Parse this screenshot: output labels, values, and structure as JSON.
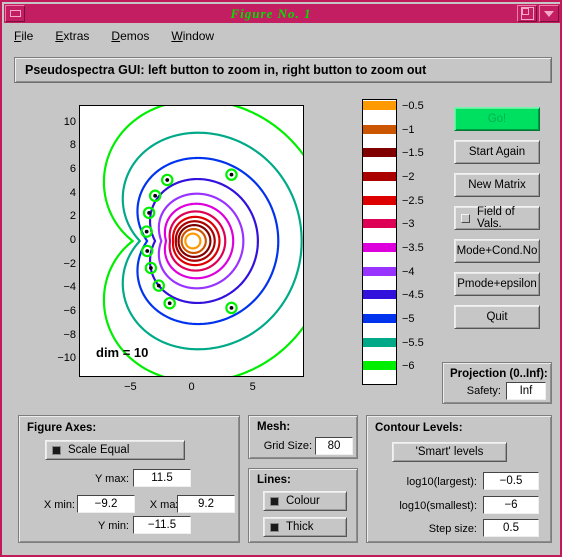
{
  "window": {
    "title": "Figure No. 1",
    "titlebar_color": "#c41e63",
    "title_text_color": "#00e000",
    "minimize_icon": "minimize-icon",
    "maximize_icon": "maximize-icon",
    "dropdown_icon": "chevron-down-icon"
  },
  "menubar": {
    "items": [
      {
        "label": "File",
        "mnemonic": "F"
      },
      {
        "label": "Extras",
        "mnemonic": "E"
      },
      {
        "label": "Demos",
        "mnemonic": "D"
      },
      {
        "label": "Window",
        "mnemonic": "W"
      }
    ]
  },
  "header": {
    "text": "Pseudospectra GUI: left button to zoom in, right button to zoom out"
  },
  "buttons": {
    "go": "Go!",
    "start_again": "Start Again",
    "new_matrix": "New Matrix",
    "field_of_vals": "Field of Vals.",
    "mode_cond_no": "Mode+Cond.No",
    "pmode_epsilon": "Pmode+epsilon",
    "quit": "Quit"
  },
  "projection": {
    "title": "Projection (0..Inf):",
    "safety_label": "Safety:",
    "safety_value": "Inf"
  },
  "figure_axes": {
    "title": "Figure Axes:",
    "scale_equal_label": "Scale Equal",
    "scale_equal_checked": true,
    "ymax_label": "Y max:",
    "ymax_value": "11.5",
    "xmin_label": "X min:",
    "xmin_value": "−9.2",
    "xmax_label": "X max:",
    "xmax_value": "9.2",
    "ymin_label": "Y min:",
    "ymin_value": "−11.5"
  },
  "mesh": {
    "title": "Mesh:",
    "grid_size_label": "Grid Size:",
    "grid_size_value": "80"
  },
  "lines": {
    "title": "Lines:",
    "colour_label": "Colour",
    "colour_checked": true,
    "thick_label": "Thick",
    "thick_checked": true
  },
  "contour_levels": {
    "title": "Contour Levels:",
    "smart_button": "'Smart' levels",
    "largest_label": "log10(largest):",
    "largest_value": "−0.5",
    "smallest_label": "log10(smallest):",
    "smallest_value": "−6",
    "step_label": "Step size:",
    "step_value": "0.5"
  },
  "chart_data": {
    "type": "line",
    "title": "",
    "annotation": "dim = 10",
    "xlabel": "",
    "ylabel": "",
    "xlim": [
      -9.2,
      9.2
    ],
    "ylim": [
      -11.5,
      11.5
    ],
    "xticks": [
      -5,
      0,
      5
    ],
    "yticks": [
      10,
      8,
      6,
      4,
      2,
      0,
      -2,
      -4,
      -6,
      -8,
      -10
    ],
    "grid": false,
    "legend": "colorbar",
    "colorbar": {
      "orientation": "vertical",
      "ticks": [
        "−0.5",
        "−1",
        "−1.5",
        "−2",
        "−2.5",
        "−3",
        "−3.5",
        "−4",
        "−4.5",
        "−5",
        "−5.5",
        "−6"
      ],
      "values": [
        -0.5,
        -1,
        -1.5,
        -2,
        -2.5,
        -3,
        -3.5,
        -4,
        -4.5,
        -5,
        -5.5,
        -6
      ],
      "colors": [
        "#ff9900",
        "#cc5500",
        "#800000",
        "#aa0000",
        "#dd0000",
        "#dd0055",
        "#dd00dd",
        "#9933ff",
        "#3311dd",
        "#0033ee",
        "#00aa88",
        "#00ee00"
      ]
    },
    "series": [
      {
        "name": "−0.5",
        "color": "#ff9900",
        "level": -0.5,
        "radius": 0.62
      },
      {
        "name": "−1",
        "color": "#cc5500",
        "level": -1,
        "radius": 1.0
      },
      {
        "name": "−1.5",
        "color": "#800000",
        "level": -1.5,
        "radius": 1.32
      },
      {
        "name": "−2",
        "color": "#aa0000",
        "level": -2,
        "radius": 1.62
      },
      {
        "name": "−2.5",
        "color": "#dd0000",
        "level": -2.5,
        "radius": 1.95
      },
      {
        "name": "−3",
        "color": "#dd0055",
        "level": -3,
        "radius": 2.35
      },
      {
        "name": "−3.5",
        "color": "#dd00dd",
        "level": -3.5,
        "radius": 2.9
      },
      {
        "name": "−4",
        "color": "#9933ff",
        "level": -4,
        "radius": 3.6
      },
      {
        "name": "−4.5",
        "color": "#3311dd",
        "level": -4.5,
        "radius": 4.6
      },
      {
        "name": "−5",
        "color": "#0033ee",
        "level": -5,
        "radius": 6.0
      },
      {
        "name": "−5.5",
        "color": "#00aa88",
        "level": -5.5,
        "radius": 7.6
      },
      {
        "name": "−6",
        "color": "#00ee00",
        "level": -6,
        "radius": 9.6
      }
    ],
    "eigenvalues": [
      {
        "x": 3.3,
        "y": 5.65
      },
      {
        "x": -2.0,
        "y": 5.2
      },
      {
        "x": -3.0,
        "y": 3.85
      },
      {
        "x": -3.5,
        "y": 2.4
      },
      {
        "x": -3.7,
        "y": 0.8
      },
      {
        "x": -3.65,
        "y": -0.85
      },
      {
        "x": -3.35,
        "y": -2.3
      },
      {
        "x": -2.7,
        "y": -3.8
      },
      {
        "x": -1.8,
        "y": -5.3
      },
      {
        "x": 3.3,
        "y": -5.7
      }
    ]
  }
}
